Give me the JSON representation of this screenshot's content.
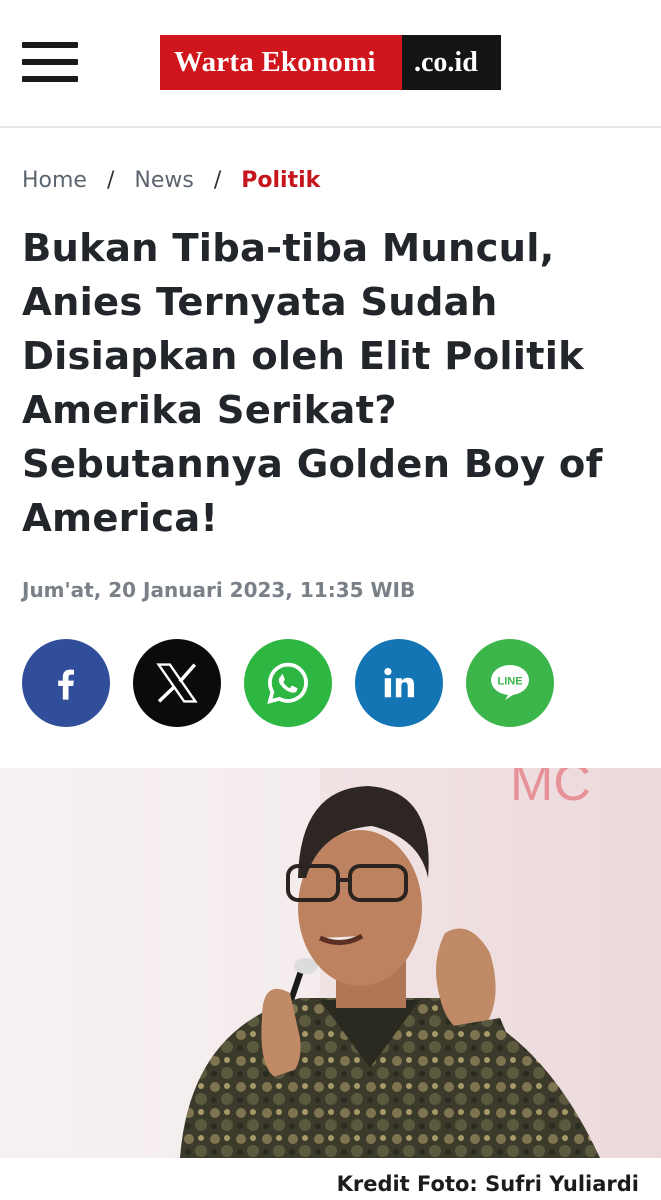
{
  "header": {
    "logo_main": "Warta Ekonomi",
    "logo_tld": ".co.id",
    "menu_icon": "hamburger-menu-icon"
  },
  "breadcrumb": {
    "items": [
      "Home",
      "News",
      "Politik"
    ],
    "separator": "/"
  },
  "article": {
    "title": "Bukan Tiba-tiba Muncul, Anies Ternyata Sudah Disiapkan oleh Elit Politik Amerika Serikat? Sebutannya Golden Boy of America!",
    "date": "Jum'at, 20 Januari 2023, 11:35 WIB",
    "photo_credit": "Kredit Foto: Sufri Yuliardi"
  },
  "share": {
    "buttons": [
      {
        "icon": "facebook-icon",
        "color": "#314e9b"
      },
      {
        "icon": "x-twitter-icon",
        "color": "#0b0b0b"
      },
      {
        "icon": "whatsapp-icon",
        "color": "#2db742"
      },
      {
        "icon": "linkedin-icon",
        "color": "#1375b4"
      },
      {
        "icon": "line-icon",
        "color": "#3cb64a",
        "label": "LINE"
      }
    ]
  },
  "colors": {
    "accent": "#c4161c",
    "logo_red": "#d0161c",
    "logo_black": "#141414"
  }
}
